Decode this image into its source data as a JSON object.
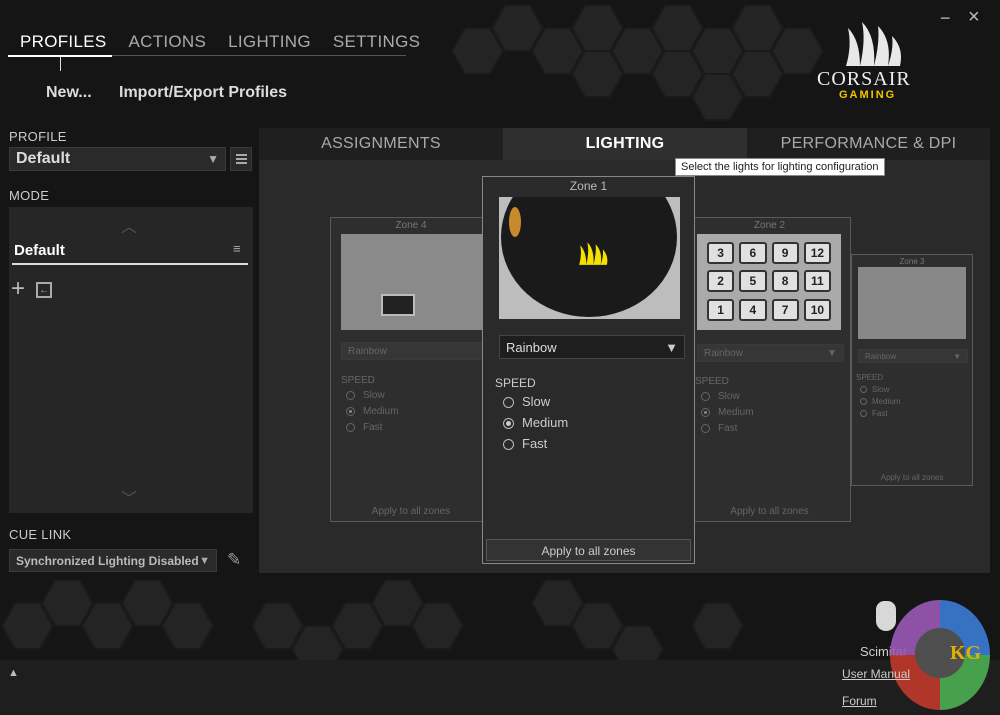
{
  "top_nav": {
    "tabs": [
      "PROFILES",
      "ACTIONS",
      "LIGHTING",
      "SETTINGS"
    ]
  },
  "sub_nav": {
    "new": "New...",
    "import_export": "Import/Export Profiles"
  },
  "brand": {
    "name": "CORSAIR",
    "sub": "GAMING",
    "accent": "#f5c400"
  },
  "window_controls": {
    "minimize": "−",
    "close": "×"
  },
  "sidebar": {
    "profile_label": "PROFILE",
    "profile_value": "Default",
    "mode_label": "MODE",
    "mode_item": "Default",
    "cue_link_label": "CUE LINK",
    "cue_link_value": "Synchronized Lighting Disabled"
  },
  "inner_tabs": [
    "ASSIGNMENTS",
    "LIGHTING",
    "PERFORMANCE & DPI"
  ],
  "tooltip": "Select the lights for lighting configuration",
  "zone1": {
    "title": "Zone 1",
    "effect": "Rainbow",
    "speed_label": "SPEED",
    "speeds": [
      "Slow",
      "Medium",
      "Fast"
    ],
    "selected": "Medium",
    "apply": "Apply to all zones"
  },
  "zone2": {
    "title": "Zone 2",
    "effect": "Rainbow",
    "speed_label": "SPEED",
    "speeds": [
      "Slow",
      "Medium",
      "Fast"
    ],
    "apply": "Apply to all zones",
    "keys": [
      "3",
      "6",
      "9",
      "12",
      "2",
      "5",
      "8",
      "11",
      "1",
      "4",
      "7",
      "10"
    ]
  },
  "zone3": {
    "title": "Zone 3",
    "effect": "Rainbow",
    "speed_label": "SPEED",
    "speeds": [
      "Slow",
      "Medium",
      "Fast"
    ],
    "apply": "Apply to all zones"
  },
  "zone4": {
    "title": "Zone 4",
    "effect": "Rainbow",
    "speed_label": "SPEED",
    "speeds": [
      "Slow",
      "Medium",
      "Fast"
    ],
    "apply": "Apply to all zones"
  },
  "device": {
    "name": "Scimitar"
  },
  "footer": {
    "user_manual": "User Manual",
    "forum": "Forum"
  },
  "watermark": {
    "text": "KG"
  }
}
